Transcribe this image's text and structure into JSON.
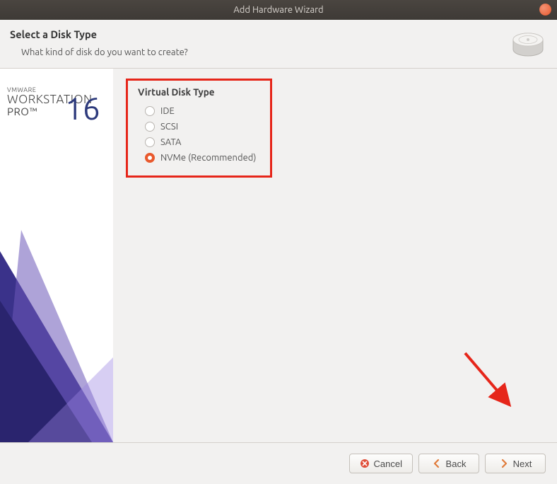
{
  "window": {
    "title": "Add Hardware Wizard"
  },
  "header": {
    "title": "Select a Disk Type",
    "subtitle": "What kind of disk do you want to create?"
  },
  "sidebar": {
    "brand_line1": "VMWARE",
    "brand_line2": "WORKSTATION",
    "brand_line3": "PRO™",
    "brand_version": "16"
  },
  "disk_type": {
    "group_title": "Virtual Disk Type",
    "options": {
      "ide": "IDE",
      "scsi": "SCSI",
      "sata": "SATA",
      "nvme": "NVMe (Recommended)"
    },
    "selected": "nvme"
  },
  "footer": {
    "cancel": "Cancel",
    "back": "Back",
    "next": "Next"
  }
}
